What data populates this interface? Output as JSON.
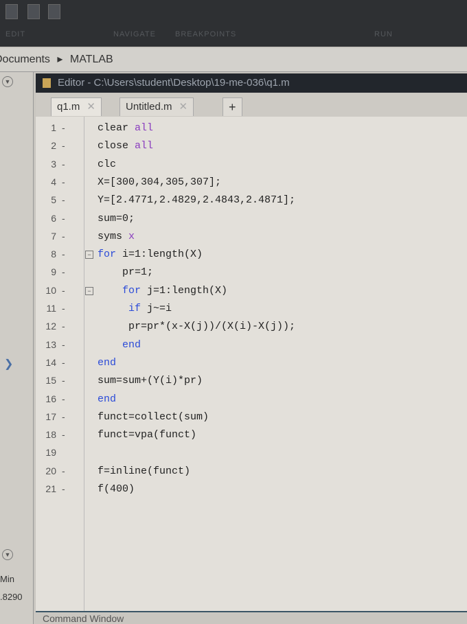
{
  "toolbar": {
    "sections": [
      "EDIT",
      "NAVIGATE",
      "BREAKPOINTS",
      "RUN"
    ]
  },
  "breadcrumb": {
    "items": [
      "Documents",
      "MATLAB"
    ]
  },
  "editor": {
    "title": "Editor - C:\\Users\\student\\Desktop\\19-me-036\\q1.m",
    "tabs": [
      {
        "label": "q1.m"
      },
      {
        "label": "Untitled.m"
      }
    ],
    "new_tab": "+"
  },
  "code": {
    "lines": [
      {
        "num": "1",
        "dash": "-",
        "seg": [
          {
            "t": "clear ",
            "c": "n"
          },
          {
            "t": "all",
            "c": "str"
          }
        ]
      },
      {
        "num": "2",
        "dash": "-",
        "seg": [
          {
            "t": "close ",
            "c": "n"
          },
          {
            "t": "all",
            "c": "str"
          }
        ]
      },
      {
        "num": "3",
        "dash": "-",
        "seg": [
          {
            "t": "clc",
            "c": "n"
          }
        ]
      },
      {
        "num": "4",
        "dash": "-",
        "seg": [
          {
            "t": "X=[300,304,305,307];",
            "c": "n"
          }
        ]
      },
      {
        "num": "5",
        "dash": "-",
        "seg": [
          {
            "t": "Y=[2.4771,2.4829,2.4843,2.4871];",
            "c": "n"
          }
        ]
      },
      {
        "num": "6",
        "dash": "-",
        "seg": [
          {
            "t": "sum=0;",
            "c": "n"
          }
        ]
      },
      {
        "num": "7",
        "dash": "-",
        "seg": [
          {
            "t": "syms ",
            "c": "n"
          },
          {
            "t": "x",
            "c": "str"
          }
        ]
      },
      {
        "num": "8",
        "dash": "-",
        "fold": true,
        "seg": [
          {
            "t": "for ",
            "c": "kw"
          },
          {
            "t": "i=1:length(X)",
            "c": "n"
          }
        ]
      },
      {
        "num": "9",
        "dash": "-",
        "seg": [
          {
            "t": "    pr=1;",
            "c": "n"
          }
        ]
      },
      {
        "num": "10",
        "dash": "-",
        "fold": true,
        "seg": [
          {
            "t": "    for ",
            "c": "kw"
          },
          {
            "t": "j=1:length(X)",
            "c": "n"
          }
        ]
      },
      {
        "num": "11",
        "dash": "-",
        "seg": [
          {
            "t": "     if ",
            "c": "kw"
          },
          {
            "t": "j~=i",
            "c": "n"
          }
        ]
      },
      {
        "num": "12",
        "dash": "-",
        "seg": [
          {
            "t": "     pr=pr*(x-X(j))/(X(i)-X(j));",
            "c": "n"
          }
        ]
      },
      {
        "num": "13",
        "dash": "-",
        "seg": [
          {
            "t": "    end",
            "c": "kw"
          }
        ]
      },
      {
        "num": "14",
        "dash": "-",
        "seg": [
          {
            "t": "end",
            "c": "kw"
          }
        ]
      },
      {
        "num": "15",
        "dash": "-",
        "seg": [
          {
            "t": "sum=sum+(Y(i)*pr)",
            "c": "n"
          }
        ]
      },
      {
        "num": "16",
        "dash": "-",
        "seg": [
          {
            "t": "end",
            "c": "kw"
          }
        ]
      },
      {
        "num": "17",
        "dash": "-",
        "seg": [
          {
            "t": "funct=collect(sum)",
            "c": "n"
          }
        ]
      },
      {
        "num": "18",
        "dash": "-",
        "seg": [
          {
            "t": "funct=vpa(funct)",
            "c": "n"
          }
        ]
      },
      {
        "num": "19",
        "dash": "",
        "seg": []
      },
      {
        "num": "20",
        "dash": "-",
        "seg": [
          {
            "t": "f=inline(funct)",
            "c": "n"
          }
        ]
      },
      {
        "num": "21",
        "dash": "-",
        "seg": [
          {
            "t": "f(400)",
            "c": "n"
          }
        ]
      }
    ]
  },
  "workspace": {
    "header": "Min",
    "value": ".8290"
  },
  "command_window": {
    "label": "Command Window"
  }
}
